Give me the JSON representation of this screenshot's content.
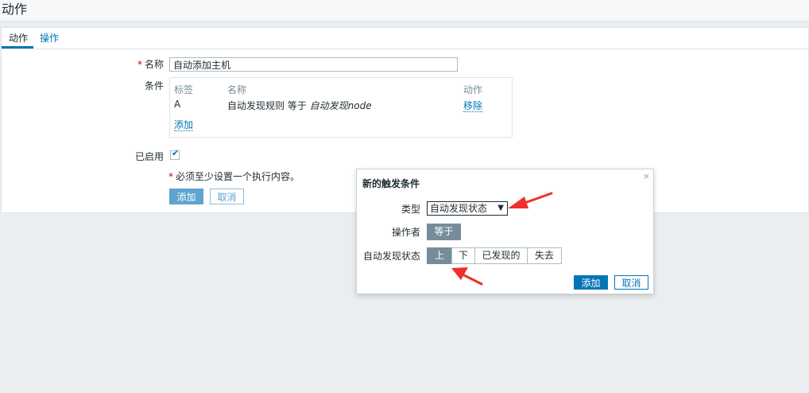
{
  "page": {
    "title": "动作"
  },
  "tabs": [
    {
      "label": "动作"
    },
    {
      "label": "操作"
    }
  ],
  "form": {
    "name_label": "名称",
    "name_value": "自动添加主机",
    "conditions_label": "条件",
    "conditions_table": {
      "headers": {
        "label": "标签",
        "name": "名称",
        "action": "动作"
      },
      "rows": [
        {
          "label": "A",
          "name_prefix": "自动发现规则 等于 ",
          "name_value": "自动发现node",
          "action": "移除"
        }
      ],
      "add_link": "添加"
    },
    "enabled_label": "已启用",
    "note": "必须至少设置一个执行内容。",
    "add_button": "添加",
    "cancel_button": "取消"
  },
  "dialog": {
    "title": "新的触发条件",
    "close_glyph": "×",
    "type_label": "类型",
    "type_value": "自动发现状态",
    "operator_label": "操作者",
    "operator_value": "等于",
    "discovery_status_label": "自动发现状态",
    "status_options": [
      "上",
      "下",
      "已发现的",
      "失去"
    ],
    "add_button": "添加",
    "cancel_button": "取消"
  },
  "colors": {
    "accent": "#0275b8",
    "annotation_arrow": "#f0302a"
  }
}
